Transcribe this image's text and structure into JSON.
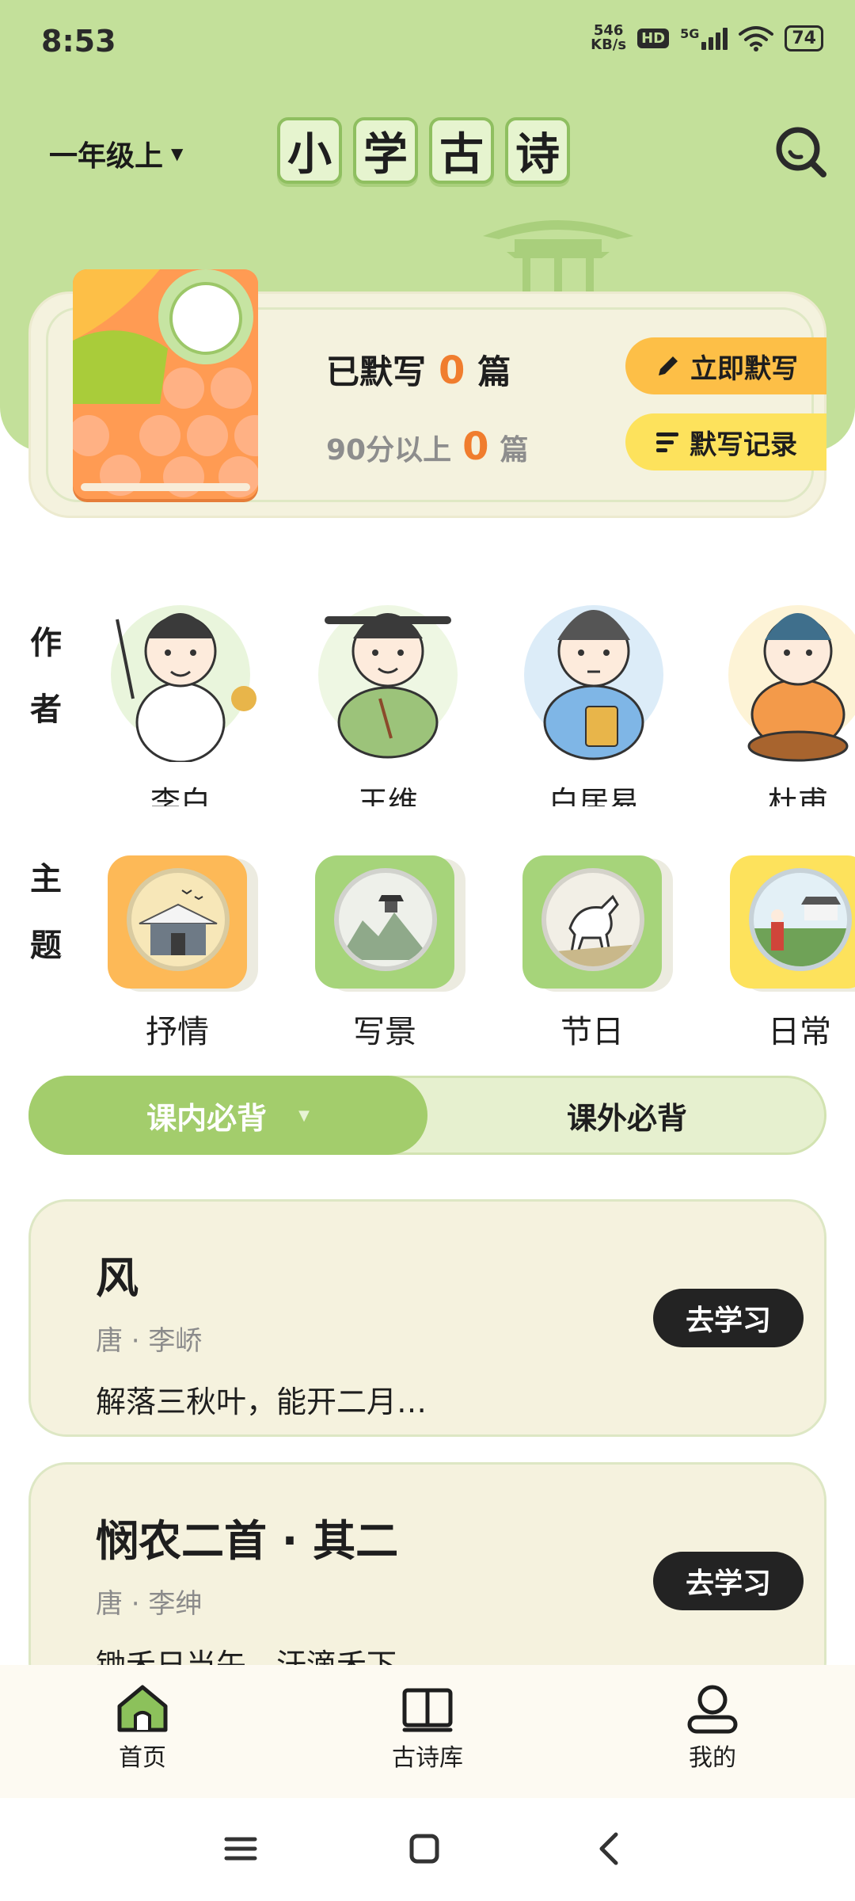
{
  "status_bar": {
    "time": "8:53",
    "net_speed_value": "546",
    "net_speed_unit": "KB/s",
    "hd": "HD",
    "network": "5G",
    "battery": "74"
  },
  "header": {
    "grade": "一年级上",
    "title_chars": [
      "小",
      "学",
      "古",
      "诗"
    ]
  },
  "dictation": {
    "written_prefix": "已默写",
    "written_count": "0",
    "written_unit": "篇",
    "above90_prefix": "90分以上",
    "above90_count": "0",
    "above90_unit": "篇",
    "start_button": "立即默写",
    "record_button": "默写记录"
  },
  "authors_section": {
    "label_chars": [
      "作",
      "者"
    ],
    "items": [
      {
        "name": "李白"
      },
      {
        "name": "王维"
      },
      {
        "name": "白居易"
      },
      {
        "name": "杜甫"
      }
    ]
  },
  "themes_section": {
    "label_chars": [
      "主",
      "题"
    ],
    "items": [
      {
        "name": "抒情",
        "color": "#fdb957"
      },
      {
        "name": "写景",
        "color": "#a6d47a"
      },
      {
        "name": "节日",
        "color": "#a6d47a"
      },
      {
        "name": "日常",
        "color": "#fde25c"
      }
    ]
  },
  "tabs": {
    "active": "课内必背",
    "other": "课外必背"
  },
  "poems": [
    {
      "title": "风",
      "author": "唐 · 李峤",
      "line": "解落三秋叶，能开二月…",
      "button": "去学习"
    },
    {
      "title": "悯农二首 · 其二",
      "author": "唐 · 李绅",
      "line": "锄禾日当午，汗滴禾下…",
      "button": "去学习"
    }
  ],
  "bottom_nav": [
    {
      "label": "首页",
      "icon": "home-icon",
      "active": true
    },
    {
      "label": "古诗库",
      "icon": "book-icon",
      "active": false
    },
    {
      "label": "我的",
      "icon": "profile-icon",
      "active": false
    }
  ],
  "colors": {
    "hero_green": "#c3e09a",
    "accent_orange": "#f07d2e",
    "tab_active": "#a3cd6c",
    "card_cream": "#f5f2de"
  }
}
